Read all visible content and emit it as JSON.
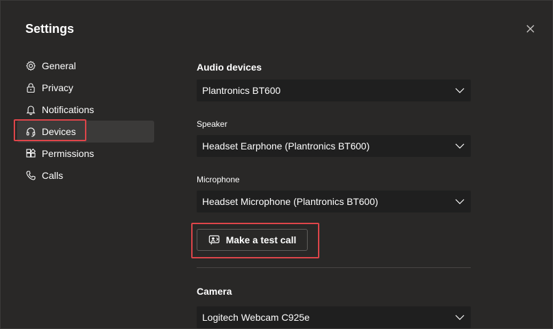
{
  "window": {
    "title": "Settings"
  },
  "sidebar": {
    "items": [
      {
        "label": "General",
        "icon": "gear-icon"
      },
      {
        "label": "Privacy",
        "icon": "lock-icon"
      },
      {
        "label": "Notifications",
        "icon": "bell-icon"
      },
      {
        "label": "Devices",
        "icon": "headset-icon",
        "active": true
      },
      {
        "label": "Permissions",
        "icon": "permissions-icon"
      },
      {
        "label": "Calls",
        "icon": "phone-icon"
      }
    ]
  },
  "main": {
    "audio": {
      "heading": "Audio devices",
      "device_value": "Plantronics BT600",
      "speaker_label": "Speaker",
      "speaker_value": "Headset Earphone (Plantronics BT600)",
      "microphone_label": "Microphone",
      "microphone_value": "Headset Microphone (Plantronics BT600)",
      "test_call_label": "Make a test call"
    },
    "camera": {
      "heading": "Camera",
      "value": "Logitech Webcam C925e"
    }
  },
  "colors": {
    "background": "#292827",
    "select_background": "#1f1f1f",
    "highlight_border": "#e0454a",
    "text": "#ffffff"
  }
}
